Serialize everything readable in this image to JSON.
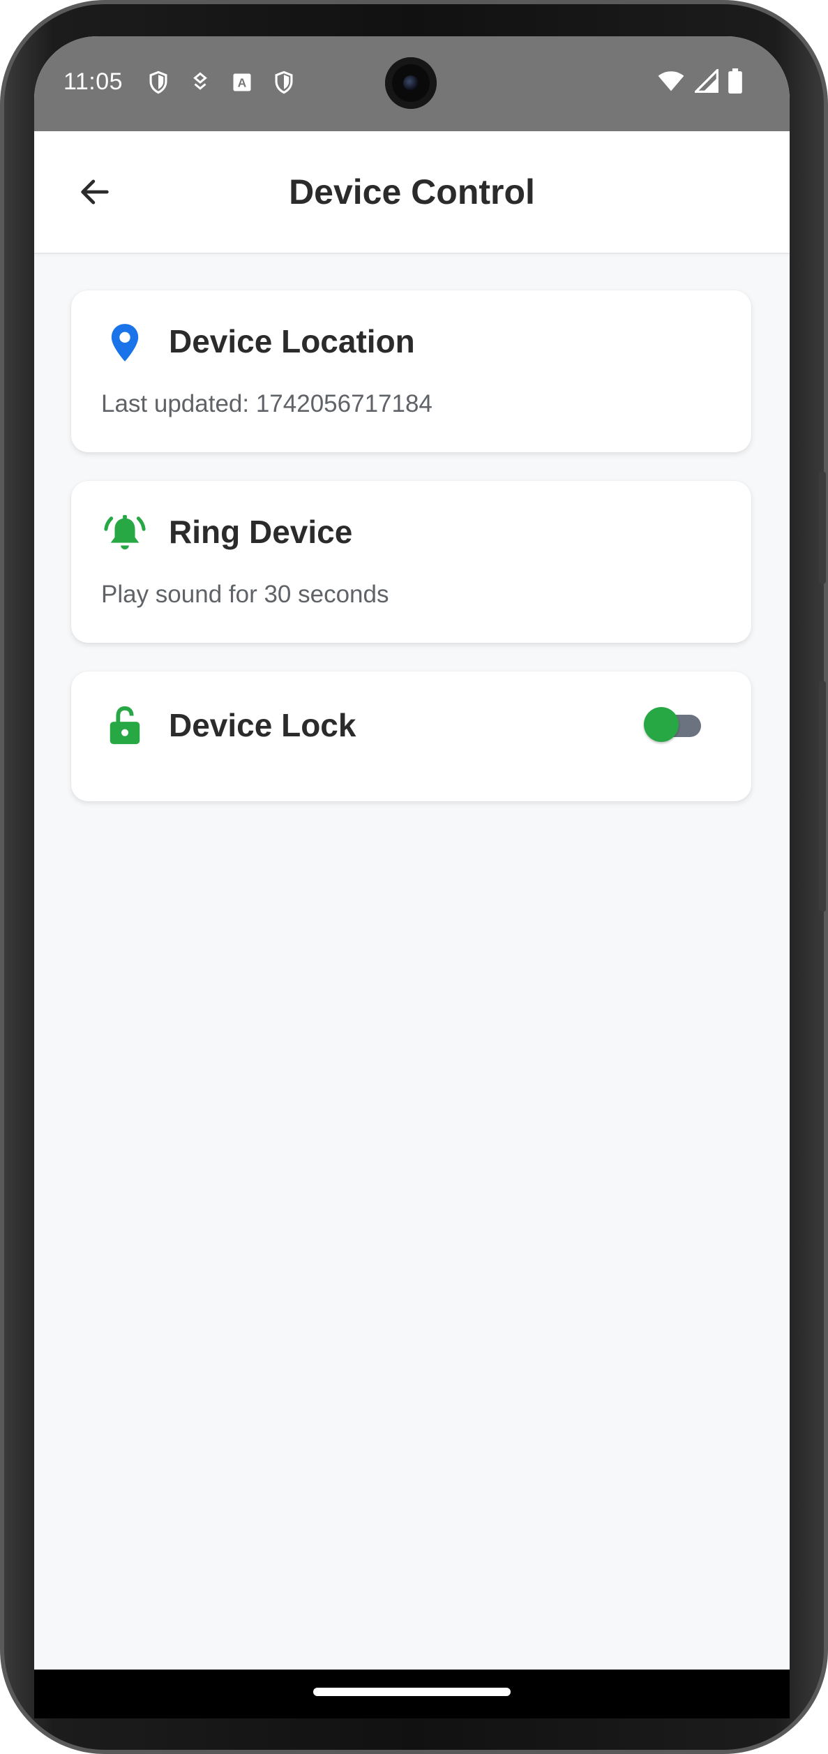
{
  "status_bar": {
    "time": "11:05",
    "left_icons": [
      "shield-icon",
      "download-badge-icon",
      "text-a-icon",
      "shield-icon"
    ],
    "right_icons": [
      "wifi-icon",
      "signal-icon",
      "battery-icon"
    ]
  },
  "app_bar": {
    "title": "Device Control",
    "back_icon": "arrow-left-icon"
  },
  "cards": {
    "location": {
      "title": "Device Location",
      "subtitle": "Last updated: 1742056717184",
      "icon": "map-pin-icon",
      "icon_color": "#1a73e8"
    },
    "ring": {
      "title": "Ring Device",
      "subtitle": "Play sound for 30 seconds",
      "icon": "ringing-bell-icon",
      "icon_color": "#28a745"
    },
    "lock": {
      "title": "Device Lock",
      "icon": "unlocked-padlock-icon",
      "icon_color": "#28a745",
      "toggle_on": false
    }
  },
  "colors": {
    "status_bar_bg": "#767676",
    "screen_bg": "#f7f8fa",
    "card_bg": "#ffffff",
    "accent_green": "#28a745",
    "accent_blue": "#1a73e8",
    "toggle_track": "#6b7280"
  }
}
